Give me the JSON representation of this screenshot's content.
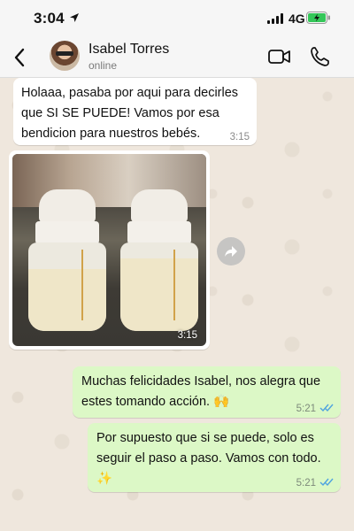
{
  "status_bar": {
    "time": "3:04",
    "network": "4G"
  },
  "header": {
    "contact_name": "Isabel Torres",
    "contact_status": "online"
  },
  "messages": [
    {
      "direction": "incoming",
      "text": "Holaaa, pasaba por aqui para decirles que SI SE PUEDE! Vamos por esa bendicion para nuestros bebés.",
      "time": "3:15"
    },
    {
      "direction": "incoming",
      "type": "image",
      "time": "3:15"
    },
    {
      "direction": "outgoing",
      "text": "Muchas felicidades Isabel, nos alegra que estes tomando acción. 🙌",
      "time": "5:21",
      "status": "read"
    },
    {
      "direction": "outgoing",
      "text": "Por supuesto que si se puede, solo es seguir el paso a paso. Vamos con todo. ✨",
      "time": "5:21",
      "status": "read"
    }
  ],
  "colors": {
    "incoming_bubble": "#ffffff",
    "outgoing_bubble": "#dcf8c6",
    "read_ticks": "#4fa3e0",
    "chat_background": "#efe7dd"
  },
  "icons": {
    "back": "chevron-left-icon",
    "video_call": "video-camera-icon",
    "voice_call": "phone-icon",
    "forward": "forward-arrow-icon"
  }
}
